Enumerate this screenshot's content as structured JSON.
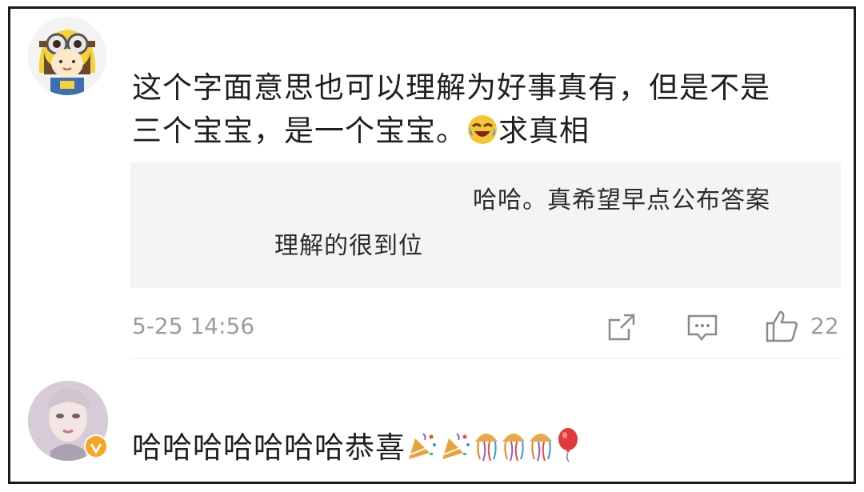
{
  "comments": [
    {
      "text_line1": "这个字面意思也可以理解为好事真有，但是不是",
      "text_line2_a": "三个宝宝，是一个宝宝。",
      "text_line2_emoji": "laughing-crying-emoji",
      "text_line2_b": "求真相",
      "reply_preview": {
        "line1": "哈哈。真希望早点公布答案",
        "line2": "理解的很到位"
      },
      "timestamp": "5-25 14:56",
      "like_count": "22"
    },
    {
      "text": "哈哈哈哈哈哈哈恭喜",
      "emojis": [
        "party-popper",
        "party-popper",
        "jellyfish",
        "jellyfish",
        "jellyfish",
        "balloon"
      ],
      "avatar_badge": "verified-badge"
    }
  ],
  "colors": {
    "text": "#1f1f1f",
    "meta": "#9b9b9b",
    "reply_bg": "#f4f4f4",
    "badge": "#f5a623"
  }
}
